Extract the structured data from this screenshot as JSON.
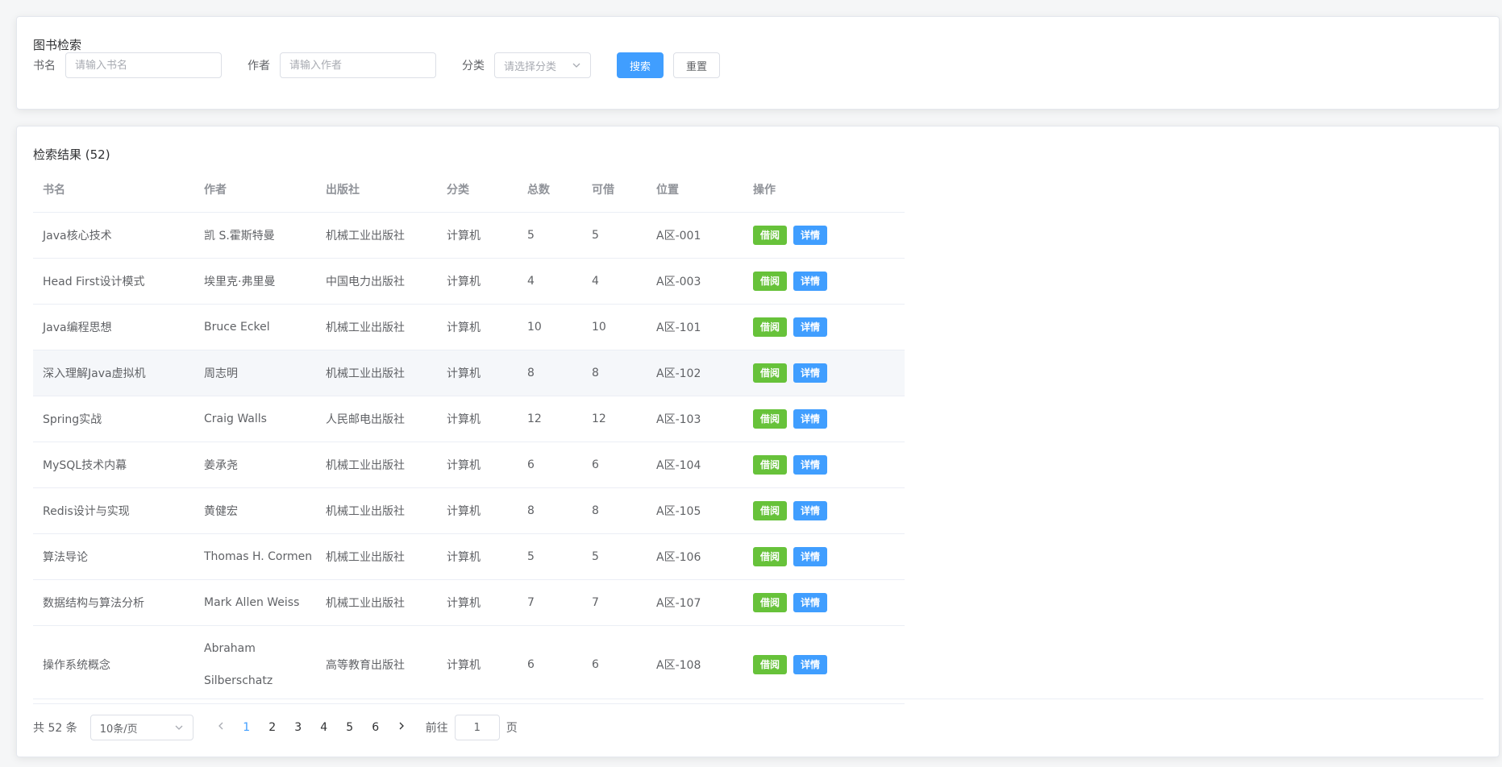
{
  "search": {
    "title": "图书检索",
    "book_label": "书名",
    "book_placeholder": "请输入书名",
    "author_label": "作者",
    "author_placeholder": "请输入作者",
    "category_label": "分类",
    "category_placeholder": "请选择分类",
    "search_button": "搜索",
    "reset_button": "重置"
  },
  "results": {
    "title": "检索结果 (52)",
    "columns": [
      "书名",
      "作者",
      "出版社",
      "分类",
      "总数",
      "可借",
      "位置",
      "操作"
    ],
    "borrow_label": "借阅",
    "detail_label": "详情",
    "rows": [
      {
        "name": "Java核心技术",
        "author": "凯 S.霍斯特曼",
        "publisher": "机械工业出版社",
        "category": "计算机",
        "total": "5",
        "available": "5",
        "location": "A区-001"
      },
      {
        "name": "Head First设计模式",
        "author": "埃里克·弗里曼",
        "publisher": "中国电力出版社",
        "category": "计算机",
        "total": "4",
        "available": "4",
        "location": "A区-003"
      },
      {
        "name": "Java编程思想",
        "author": "Bruce Eckel",
        "publisher": "机械工业出版社",
        "category": "计算机",
        "total": "10",
        "available": "10",
        "location": "A区-101"
      },
      {
        "name": "深入理解Java虚拟机",
        "author": "周志明",
        "publisher": "机械工业出版社",
        "category": "计算机",
        "total": "8",
        "available": "8",
        "location": "A区-102"
      },
      {
        "name": "Spring实战",
        "author": "Craig Walls",
        "publisher": "人民邮电出版社",
        "category": "计算机",
        "total": "12",
        "available": "12",
        "location": "A区-103"
      },
      {
        "name": "MySQL技术内幕",
        "author": "姜承尧",
        "publisher": "机械工业出版社",
        "category": "计算机",
        "total": "6",
        "available": "6",
        "location": "A区-104"
      },
      {
        "name": "Redis设计与实现",
        "author": "黄健宏",
        "publisher": "机械工业出版社",
        "category": "计算机",
        "total": "8",
        "available": "8",
        "location": "A区-105"
      },
      {
        "name": "算法导论",
        "author": "Thomas H. Cormen",
        "publisher": "机械工业出版社",
        "category": "计算机",
        "total": "5",
        "available": "5",
        "location": "A区-106"
      },
      {
        "name": "数据结构与算法分析",
        "author": "Mark Allen Weiss",
        "publisher": "机械工业出版社",
        "category": "计算机",
        "total": "7",
        "available": "7",
        "location": "A区-107"
      },
      {
        "name": "操作系统概念",
        "author": "Abraham Silberschatz",
        "publisher": "高等教育出版社",
        "category": "计算机",
        "total": "6",
        "available": "6",
        "location": "A区-108"
      }
    ]
  },
  "pagination": {
    "total_text": "共 52 条",
    "page_size": "10条/页",
    "pages": [
      "1",
      "2",
      "3",
      "4",
      "5",
      "6"
    ],
    "current_page": "1",
    "goto_label": "前往",
    "goto_value": "1",
    "page_suffix": "页"
  },
  "colors": {
    "primary": "#409eff",
    "success": "#67c23a",
    "hover_row": "#f5f7fa"
  },
  "icons": {
    "select_arrow": "chevron-down-icon",
    "prev": "chevron-left-icon",
    "next": "chevron-right-icon"
  }
}
